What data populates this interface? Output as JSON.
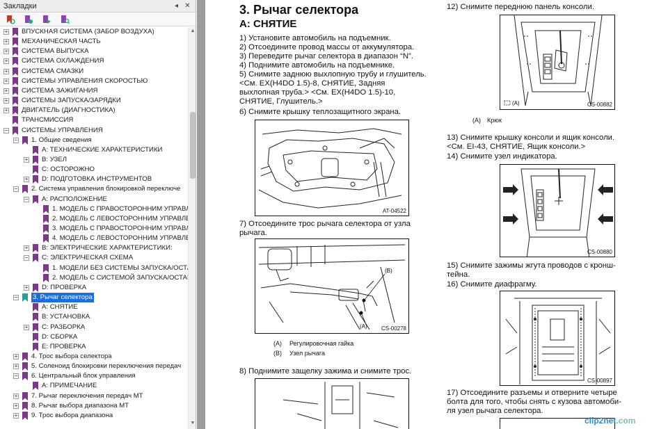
{
  "sidebar": {
    "title": "Закладки",
    "controls": [
      "◂",
      "✕"
    ],
    "toolbar_icons": [
      "bookmark-options-icon",
      "new-bookmark-icon",
      "expand-bookmark-icon",
      "find-bookmark-icon"
    ],
    "tree": [
      {
        "label": "ВПУСКНАЯ СИСТЕМА (ЗАБОР ВОЗДУХА)",
        "level": 0,
        "expander": "+"
      },
      {
        "label": "МЕХАНИЧЕСКАЯ ЧАСТЬ",
        "level": 0,
        "expander": "+"
      },
      {
        "label": "СИСТЕМА ВЫПУСКА",
        "level": 0,
        "expander": "+"
      },
      {
        "label": "СИСТЕМА ОХЛАЖДЕНИЯ",
        "level": 0,
        "expander": "+"
      },
      {
        "label": "СИСТЕМА СМАЗКИ",
        "level": 0,
        "expander": "+"
      },
      {
        "label": "СИСТЕМЫ УПРАВЛЕНИЯ СКОРОСТЬЮ",
        "level": 0,
        "expander": "+"
      },
      {
        "label": "СИСТЕМА ЗАЖИГАНИЯ",
        "level": 0,
        "expander": "+"
      },
      {
        "label": "СИСТЕМЫ ЗАПУСКА/ЗАРЯДКИ",
        "level": 0,
        "expander": "+"
      },
      {
        "label": "ДВИГАТЕЛЬ (ДИАГНОСТИКА)",
        "level": 0,
        "expander": "+"
      },
      {
        "label": "ТРАНСМИССИЯ",
        "level": 0,
        "expander": ""
      },
      {
        "label": "СИСТЕМЫ УПРАВЛЕНИЯ",
        "level": 0,
        "expander": "−"
      },
      {
        "label": "1. Общие сведения",
        "level": 1,
        "expander": "−"
      },
      {
        "label": "A: ТЕХНИЧЕСКИЕ ХАРАКТЕРИСТИКИ",
        "level": 2,
        "expander": ""
      },
      {
        "label": "B: УЗЕЛ",
        "level": 2,
        "expander": "+"
      },
      {
        "label": "C: ОСТОРОЖНО",
        "level": 2,
        "expander": ""
      },
      {
        "label": "D: ПОДГОТОВКА ИНСТРУМЕНТОВ",
        "level": 2,
        "expander": "+"
      },
      {
        "label": "2. Система управления блокировкой переключе",
        "level": 1,
        "expander": "−"
      },
      {
        "label": "A: РАСПОЛОЖЕНИЕ",
        "level": 2,
        "expander": "−"
      },
      {
        "label": "1. МОДЕЛЬ С ПРАВОСТОРОННИМ УПРАВЛЕ",
        "level": 3,
        "expander": ""
      },
      {
        "label": "2. МОДЕЛЬ С ЛЕВОСТОРОННИМ УПРАВЛЕН",
        "level": 3,
        "expander": ""
      },
      {
        "label": "3. МОДЕЛЬ С ПРАВОСТОРОННИМ УПРАВЛЕ",
        "level": 3,
        "expander": ""
      },
      {
        "label": "4. МОДЕЛЬ С ЛЕВОСТОРОННИМ УПРАВЛЕН",
        "level": 3,
        "expander": ""
      },
      {
        "label": "B: ЭЛЕКТРИЧЕСКИЕ ХАРАКТЕРИСТИКИ:",
        "level": 2,
        "expander": "+"
      },
      {
        "label": "C: ЭЛЕКТРИЧЕСКАЯ СХЕМА",
        "level": 2,
        "expander": "−"
      },
      {
        "label": "1. МОДЕЛИ БЕЗ СИСТЕМЫ ЗАПУСКА/ОСТАН",
        "level": 3,
        "expander": ""
      },
      {
        "label": "2. МОДЕЛЬ С СИСТЕМОЙ ЗАПУСКА/ОСТАН",
        "level": 3,
        "expander": ""
      },
      {
        "label": "D: ПРОВЕРКА",
        "level": 2,
        "expander": "+"
      },
      {
        "label": "3. Рычаг селектора",
        "level": 1,
        "expander": "−",
        "selected": true
      },
      {
        "label": "A: СНЯТИЕ",
        "level": 2,
        "expander": ""
      },
      {
        "label": "B: УСТАНОВКА",
        "level": 2,
        "expander": ""
      },
      {
        "label": "C: РАЗБОРКА",
        "level": 2,
        "expander": "+"
      },
      {
        "label": "D: СБОРКА",
        "level": 2,
        "expander": ""
      },
      {
        "label": "E: ПРОВЕРКА",
        "level": 2,
        "expander": ""
      },
      {
        "label": "4. Трос выбора селектора",
        "level": 1,
        "expander": "+"
      },
      {
        "label": "5. Соленоид блокировки переключения передач",
        "level": 1,
        "expander": "+"
      },
      {
        "label": "6. Центральный блок управления",
        "level": 1,
        "expander": "−"
      },
      {
        "label": "A: ПРИМЕЧАНИЕ",
        "level": 2,
        "expander": ""
      },
      {
        "label": "7. Рычаг переключения передач МТ",
        "level": 1,
        "expander": "+"
      },
      {
        "label": "8. Рычаг выбора диапазона МТ",
        "level": 1,
        "expander": "+"
      },
      {
        "label": "9. Трос выбора диапазона",
        "level": 1,
        "expander": "+"
      }
    ]
  },
  "document": {
    "title": "3.  Рычаг селектора",
    "subtitle": "A:  СНЯТИЕ",
    "left_col": [
      "1) Установите автомобиль на подъемник.",
      "2) Отсоедините провод массы от аккумулятора.",
      "3) Переведите рычаг селектора в диапазон “N”.",
      "4) Поднимите автомобиль на подъемнике.",
      "5) Снимите заднюю выхлопную трубу и глушитель.",
      "<См. EX(H4DO 1.5)-8, СНЯТИЕ, Задняя",
      "выхлопная труба.> <См. EX(H4DO 1.5)-10,",
      "СНЯТИЕ, Глушитель.>",
      "6) Снимите крышку теплозащитного экрана."
    ],
    "step7": [
      "7) Отсоедините трос рычага селектора от узла",
      "рычага."
    ],
    "step8": "8) Поднимите защелку зажима и снимите трос.",
    "fig1_id": "AT-04522",
    "fig2_id": "CS-00278",
    "fig2_labels": {
      "a": "(A)",
      "b": "(B)"
    },
    "fig2_legend": [
      {
        "key": "(A)",
        "text": "Регулировочная гайка"
      },
      {
        "key": "(B)",
        "text": "Узел рычага"
      }
    ],
    "right_col": {
      "step12": "12) Снимите переднюю панель консоли.",
      "fig3_id": "CS-00882",
      "fig3_inline": "(A)",
      "fig3_legend": {
        "key": "(A)",
        "text": "Крюк"
      },
      "step13": [
        "13) Снимите крышку консоли и ящик консоли.",
        "<См. EI-43, СНЯТИЕ, Ящик консоли.>"
      ],
      "step14": "14) Снимите узел индикатора.",
      "fig4_id": "CS-00880",
      "step15": [
        "15) Снимите зажимы жгута проводов с кронш-",
        "тейна."
      ],
      "step16": "16) Снимите диафрагму.",
      "fig5_id": "CS-00897",
      "step17": [
        "17) Отсоедините разъемы и отверните четыре",
        "болта для того, чтобы снять с кузова автомоби-",
        "ля узел рычага селектора."
      ]
    }
  },
  "watermark": {
    "brand": "clip2net",
    "suffix": ".com"
  },
  "colors": {
    "bookmark": "#7a3a86",
    "selection": "#1e6ed6",
    "doc_bg": "#9b9b9b"
  }
}
